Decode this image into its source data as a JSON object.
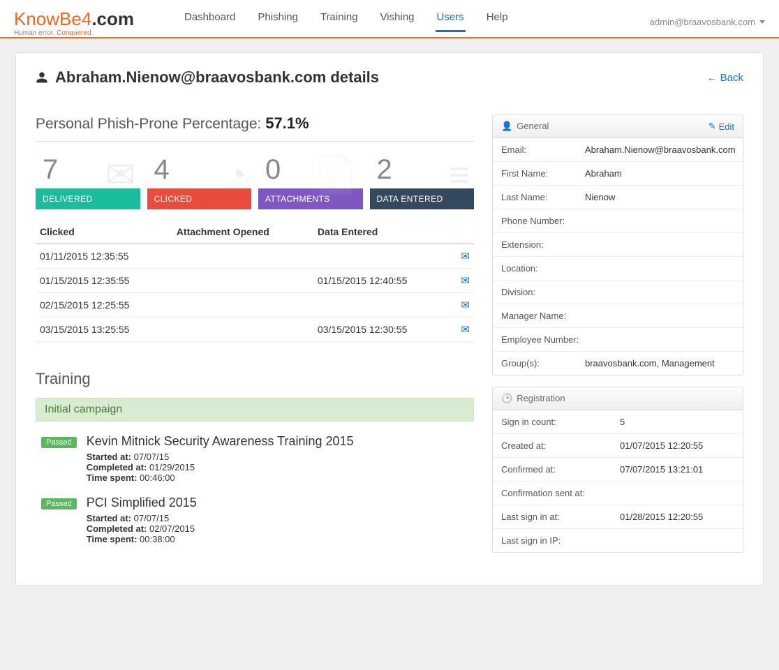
{
  "header": {
    "logo_main": "KnowBe4",
    "logo_suffix": ".com",
    "logo_sub_a": "Human error.",
    "logo_sub_b": "Conquered.",
    "account_email": "admin@braavosbank.com"
  },
  "nav": [
    {
      "label": "Dashboard",
      "active": false
    },
    {
      "label": "Phishing",
      "active": false
    },
    {
      "label": "Training",
      "active": false
    },
    {
      "label": "Vishing",
      "active": false
    },
    {
      "label": "Users",
      "active": true
    },
    {
      "label": "Help",
      "active": false
    }
  ],
  "page": {
    "title": "Abraham.Nienow@braavosbank.com details",
    "back_label": "Back"
  },
  "ppp": {
    "label": "Personal Phish-Prone Percentage: ",
    "value": "57.1%"
  },
  "stats": [
    {
      "value": "7",
      "label": "DELIVERED",
      "color": "bg-green",
      "icon": "✉"
    },
    {
      "value": "4",
      "label": "CLICKED",
      "color": "bg-red",
      "icon": "◔"
    },
    {
      "value": "0",
      "label": "ATTACHMENTS",
      "color": "bg-purple",
      "icon": "📄"
    },
    {
      "value": "2",
      "label": "DATA ENTERED",
      "color": "bg-dark",
      "icon": "≡"
    }
  ],
  "phish_table": {
    "headers": [
      "Clicked",
      "Attachment Opened",
      "Data Entered",
      ""
    ],
    "rows": [
      {
        "clicked": "01/11/2015 12:35:55",
        "opened": "",
        "entered": ""
      },
      {
        "clicked": "01/15/2015 12:35:55",
        "opened": "",
        "entered": "01/15/2015 12:40:55"
      },
      {
        "clicked": "02/15/2015 12:25:55",
        "opened": "",
        "entered": ""
      },
      {
        "clicked": "03/15/2015 13:25:55",
        "opened": "",
        "entered": "03/15/2015 12:30:55"
      }
    ]
  },
  "training": {
    "heading": "Training",
    "campaign": "Initial campaign",
    "passed_label": "Passed",
    "labels": {
      "started": "Started at:",
      "completed": "Completed at:",
      "time": "Time spent:"
    },
    "items": [
      {
        "title": "Kevin Mitnick Security Awareness Training 2015",
        "started": "07/07/15",
        "completed": "01/29/2015",
        "time": "00:46:00"
      },
      {
        "title": "PCI Simplified 2015",
        "started": "07/07/15",
        "completed": "02/07/2015",
        "time": "00:38:00"
      }
    ]
  },
  "general": {
    "title": "General",
    "edit_label": "Edit",
    "fields": {
      "Email:": "Abraham.Nienow@braavosbank.com",
      "First Name:": "Abraham",
      "Last Name:": "Nienow",
      "Phone Number:": "",
      "Extension:": "",
      "Location:": "",
      "Division:": "",
      "Manager Name:": "",
      "Employee Number:": "",
      "Group(s):": "braavosbank.com, Management"
    }
  },
  "registration": {
    "title": "Registration",
    "fields": {
      "Sign in count:": "5",
      "Created at:": "01/07/2015 12:20:55",
      "Confirmed at:": "07/07/2015 13:21:01",
      "Confirmation sent at:": "",
      "Last sign in at:": "01/28/2015 12:20:55",
      "Last sign in IP:": ""
    }
  }
}
